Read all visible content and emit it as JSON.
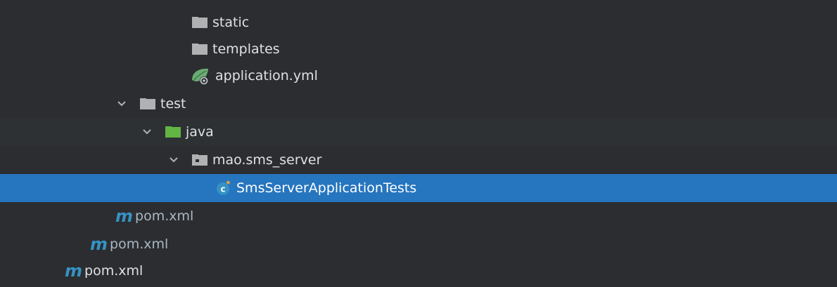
{
  "project_tree": {
    "items": [
      {
        "label": "static",
        "kind": "folder"
      },
      {
        "label": "templates",
        "kind": "folder"
      },
      {
        "label": "application.yml",
        "kind": "spring-yml"
      },
      {
        "label": "test",
        "kind": "folder",
        "expanded": true
      },
      {
        "label": "java",
        "kind": "test-source-folder",
        "expanded": true
      },
      {
        "label": "mao.sms_server",
        "kind": "package",
        "expanded": true
      },
      {
        "label": "SmsServerApplicationTests",
        "kind": "java-class",
        "selected": true
      },
      {
        "label": "pom.xml",
        "kind": "maven"
      },
      {
        "label": "pom.xml",
        "kind": "maven"
      },
      {
        "label": "pom.xml",
        "kind": "maven"
      }
    ],
    "maven_glyph": "m"
  },
  "colors": {
    "background": "#2b2d30",
    "selection": "#2675bf",
    "folder_grey": "#afb1b3",
    "test_folder_green": "#62b543",
    "maven_blue": "#3592c4",
    "spring_green": "#6aab73"
  },
  "icons": {
    "folder": "folder-icon",
    "test_folder": "test-folder-icon",
    "package": "package-icon",
    "spring_yml": "spring-leaf-icon",
    "java_class": "java-class-icon",
    "maven": "maven-m-icon",
    "expand": "chevron-down-icon"
  }
}
